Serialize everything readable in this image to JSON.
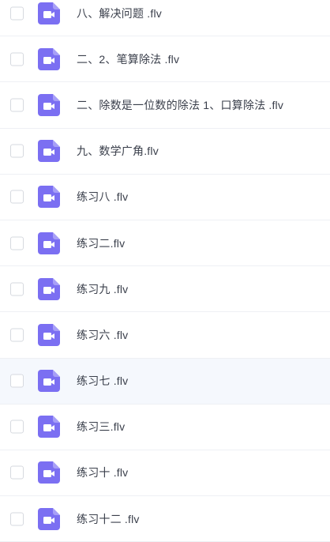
{
  "files": [
    {
      "name": "八、解决问题 .flv",
      "icon": "video-file-icon"
    },
    {
      "name": "二、2、笔算除法 .flv",
      "icon": "video-file-icon"
    },
    {
      "name": "二、除数是一位数的除法 1、口算除法 .flv",
      "icon": "video-file-icon"
    },
    {
      "name": "九、数学广角.flv",
      "icon": "video-file-icon"
    },
    {
      "name": "练习八 .flv",
      "icon": "video-file-icon"
    },
    {
      "name": "练习二.flv",
      "icon": "video-file-icon"
    },
    {
      "name": "练习九 .flv",
      "icon": "video-file-icon"
    },
    {
      "name": "练习六 .flv",
      "icon": "video-file-icon"
    },
    {
      "name": "练习七 .flv",
      "icon": "video-file-icon"
    },
    {
      "name": "练习三.flv",
      "icon": "video-file-icon"
    },
    {
      "name": "练习十 .flv",
      "icon": "video-file-icon"
    },
    {
      "name": "练习十二 .flv",
      "icon": "video-file-icon"
    }
  ],
  "colors": {
    "icon_bg": "#7b6ff2",
    "text": "#3a3f4b",
    "hover_row": "#f5f8fd",
    "divider": "#eef0f4"
  }
}
